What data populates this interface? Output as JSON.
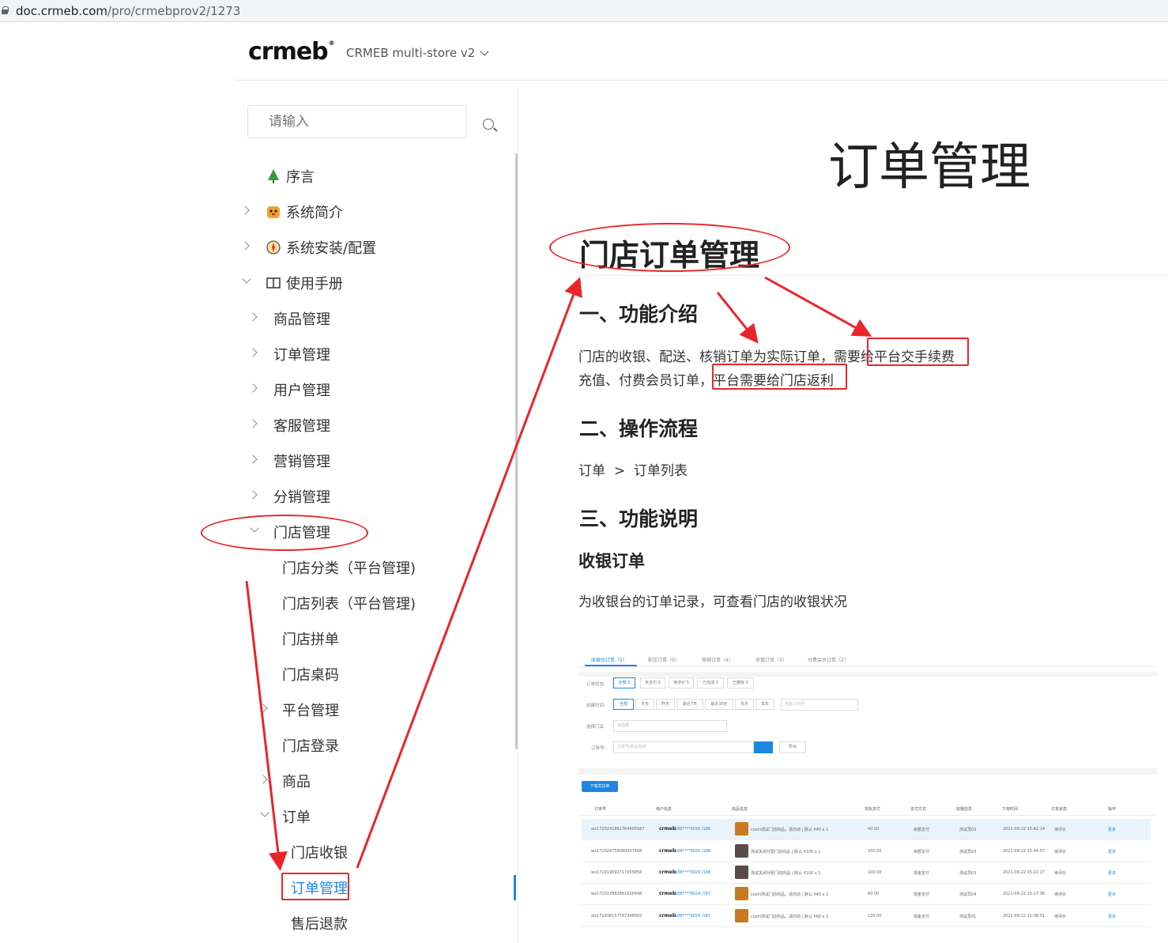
{
  "browser": {
    "url_host": "doc.crmeb.com",
    "url_path": "/pro/crmebprov2/1273"
  },
  "header": {
    "logo_text": "crmeb",
    "logo_reg": "®",
    "version_label": "CRMEB multi-store v2"
  },
  "sidebar": {
    "search_placeholder": "请输入",
    "items": [
      {
        "label": "序言",
        "icon": "tree-icon"
      },
      {
        "label": "系统简介",
        "icon": "tiger-icon"
      },
      {
        "label": "系统安装/配置",
        "icon": "compass-icon"
      },
      {
        "label": "使用手册",
        "icon": "book-icon"
      },
      {
        "label": "商品管理"
      },
      {
        "label": "订单管理"
      },
      {
        "label": "用户管理"
      },
      {
        "label": "客服管理"
      },
      {
        "label": "营销管理"
      },
      {
        "label": "分销管理"
      },
      {
        "label": "门店管理"
      },
      {
        "label": "门店分类（平台管理)"
      },
      {
        "label": "门店列表（平台管理)"
      },
      {
        "label": "门店拼单"
      },
      {
        "label": "门店桌码"
      },
      {
        "label": "平台管理"
      },
      {
        "label": "门店登录"
      },
      {
        "label": "商品"
      },
      {
        "label": "订单"
      },
      {
        "label": "门店收银"
      },
      {
        "label": "订单管理"
      },
      {
        "label": "售后退款"
      }
    ]
  },
  "content": {
    "page_title": "订单管理",
    "h1": "门店订单管理",
    "section1_title": "一、功能介绍",
    "section1_line1_a": "门店的收银、配送、核销订单为实际订单，需要",
    "section1_line1_b": "给平台交手续费",
    "section1_line2_a": "充值、付费会员订单，",
    "section1_line2_b": "平台需要给门店返利",
    "section2_title": "二、操作流程",
    "flow_a": "订单",
    "flow_sep": ">",
    "flow_b": "订单列表",
    "section3_title": "三、功能说明",
    "sub_title": "收银订单",
    "sub_desc": "为收银台的订单记录，可查看门店的收银状况"
  },
  "screenshot": {
    "tabs": [
      "收银台订单（5）",
      "配送订单（9）",
      "核销订单（4）",
      "充值订单（3）",
      "付费会员订单（2）"
    ],
    "status_label": "订单状态:",
    "status_options": [
      "全部 5",
      "未支付 0",
      "待评价 5",
      "已完成 0",
      "已删除 0"
    ],
    "time_label": "创建时间:",
    "time_options": [
      "全部",
      "今天",
      "昨天",
      "最近7天",
      "最近30天",
      "本月",
      "本年"
    ],
    "time_custom": "自定义时间",
    "store_label": "选择门店:",
    "store_placeholder": "请选择",
    "order_label": "订单号:",
    "order_placeholder": "订单号/商品名称",
    "export_label": "导出",
    "download_label": "下载发货单",
    "columns": [
      "订单号",
      "用户信息",
      "商品信息",
      "实际支付",
      "支付方式",
      "收银店员",
      "下单时间",
      "订单状态",
      "操作"
    ],
    "rows": [
      {
        "id": "wx1720241861764405587",
        "user": "188****9026 /188",
        "goods": "coshi测试门店商品，请勿动 | 默认  ¥40 x 1",
        "pay": "40.00",
        "method": "余额支付",
        "clerk": "测试员03",
        "time": "2021-09-22 15:42:14",
        "status": "待评价",
        "op": "更多"
      },
      {
        "id": "wx172024759089937408",
        "user": "188****9026 /188",
        "goods": "测试关闭分配门店商品 | 默认       ¥100 x 1",
        "pay": "100.00",
        "method": "余额支付",
        "clerk": "测试员03",
        "time": "2021-09-22 15:44:57",
        "status": "待评价",
        "op": "更多"
      },
      {
        "id": "wx172019092717305856",
        "user": "188****9026 /188",
        "goods": "测试关闭分配门店商品 | 默认       ¥100 x 1",
        "pay": "100.00",
        "method": "现金支付",
        "clerk": "测试员03",
        "time": "2021-09-22 15:22:27",
        "status": "待评价",
        "op": "更多"
      },
      {
        "id": "wx172017882861928448",
        "user": "188****9024 /187",
        "goods": "coshi测试门店商品，请勿动 | 默认  ¥40 x 1",
        "pay": "60.00",
        "method": "现金支付",
        "clerk": "测试员04",
        "time": "2021-09-22 15:17:30",
        "status": "待评价",
        "op": "更多"
      },
      {
        "id": "wx171938157787348992",
        "user": "188****9024 /187",
        "goods": "coshi测试门店商品，请勿动 | 默认  ¥60 x 2",
        "pay": "120.00",
        "method": "现金支付",
        "clerk": "测试员01",
        "time": "2021-09-22 11:08:51",
        "status": "待评价",
        "op": "更多"
      }
    ]
  },
  "colors": {
    "accent": "#1f86e0",
    "annotation": "#e8262a"
  }
}
